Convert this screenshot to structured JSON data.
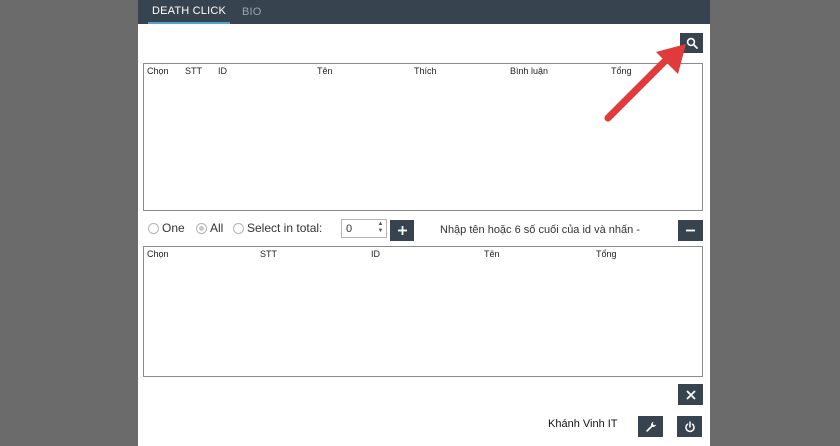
{
  "tabs": [
    {
      "label": "DEATH CLICK",
      "active": true
    },
    {
      "label": "BIO",
      "active": false
    }
  ],
  "top_table": {
    "columns": [
      "Chọn",
      "STT",
      "ID",
      "Tên",
      "Thích",
      "Bình luận",
      "Tổng"
    ]
  },
  "options": {
    "one_label": "One",
    "all_label": "All",
    "select_total_label": "Select in total:",
    "selected": "All",
    "total_value": "0"
  },
  "hint_text": "Nhập tên hoặc 6 số cuối của id và nhấn -",
  "bottom_table": {
    "columns": [
      "Chọn",
      "STT",
      "ID",
      "Tên",
      "Tổng"
    ]
  },
  "footer": {
    "author": "Khánh Vinh IT"
  },
  "icons": {
    "search": "search-icon",
    "add": "plus-icon",
    "remove": "minus-icon",
    "close": "close-icon",
    "settings": "wrench-icon",
    "power": "power-icon"
  },
  "colors": {
    "button_bg": "#37444f",
    "tab_accent": "#4fa3d8",
    "annotation_arrow": "#e03a3a"
  }
}
